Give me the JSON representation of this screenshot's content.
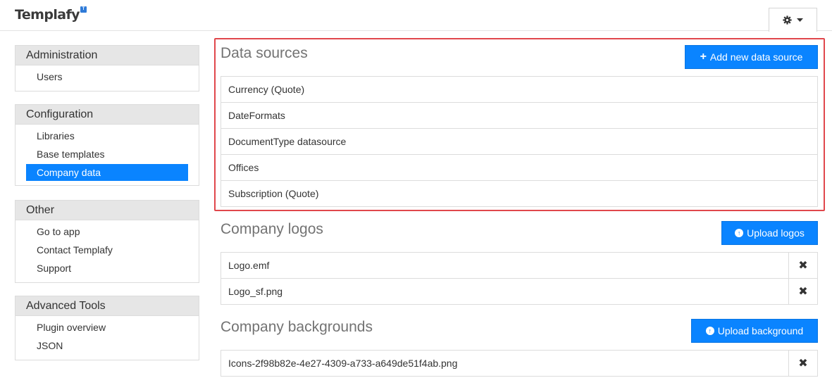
{
  "header": {
    "logo_text": "Templafy",
    "logo_badge": "T",
    "settings_icon": "gear-icon",
    "caret_icon": "caret-down-icon"
  },
  "sidebar": {
    "administration": {
      "title": "Administration",
      "items": [
        "Users"
      ]
    },
    "configuration": {
      "title": "Configuration",
      "items": [
        "Libraries",
        "Base templates",
        "Company data"
      ],
      "active": "Company data"
    },
    "other": {
      "title": "Other",
      "items": [
        "Go to app",
        "Contact Templafy",
        "Support"
      ]
    },
    "advanced": {
      "title": "Advanced Tools",
      "items": [
        "Plugin overview",
        "JSON"
      ]
    }
  },
  "data_sources": {
    "title": "Data sources",
    "add_button": "Add new data source",
    "add_icon": "plus-icon",
    "rows": [
      "Currency (Quote)",
      "DateFormats",
      "DocumentType datasource",
      "Offices",
      "Subscription (Quote)"
    ]
  },
  "company_logos": {
    "title": "Company logos",
    "upload_button": "Upload logos",
    "upload_icon": "upload-circle-icon",
    "rows": [
      "Logo.emf",
      "Logo_sf.png"
    ],
    "delete_icon": "close-icon"
  },
  "company_backgrounds": {
    "title": "Company backgrounds",
    "upload_button": "Upload background",
    "upload_icon": "upload-circle-icon",
    "rows": [
      "Icons-2f98b82e-4e27-4309-a733-a649de51f4ab.png"
    ],
    "delete_icon": "close-icon"
  },
  "colors": {
    "primary": "#0a84ff",
    "highlight": "#e0474c",
    "panel_header": "#e6e6e6"
  }
}
